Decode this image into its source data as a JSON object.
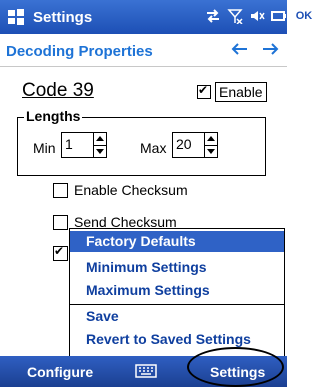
{
  "window": {
    "title": "Settings",
    "ok_label": "OK"
  },
  "subheader": {
    "heading": "Decoding Properties"
  },
  "symbology": {
    "name": "Code 39",
    "enable_label": "Enable",
    "enabled": true
  },
  "lengths": {
    "legend": "Lengths",
    "min_label": "Min",
    "min_value": "1",
    "max_label": "Max",
    "max_value": "20"
  },
  "options": {
    "enable_checksum": {
      "label": "Enable Checksum",
      "checked": false
    },
    "send_checksum": {
      "label": "Send Checksum",
      "checked": false
    },
    "third_checked": true
  },
  "menu": {
    "items": [
      "Factory Defaults",
      "Minimum Settings",
      "Maximum Settings",
      "Save",
      "Revert to Saved Settings"
    ]
  },
  "bottombar": {
    "left": "Configure",
    "right": "Settings"
  },
  "colors": {
    "accent_blue": "#1d4fb5",
    "heading_blue": "#1e73d6",
    "menu_selected": "#2f62c6",
    "menu_text": "#0f3f9f"
  },
  "icons": [
    "windows-logo-icon",
    "connectivity-icon",
    "signal-off-icon",
    "volume-icon",
    "battery-icon",
    "arrow-left-icon",
    "arrow-right-icon",
    "keyboard-icon"
  ]
}
